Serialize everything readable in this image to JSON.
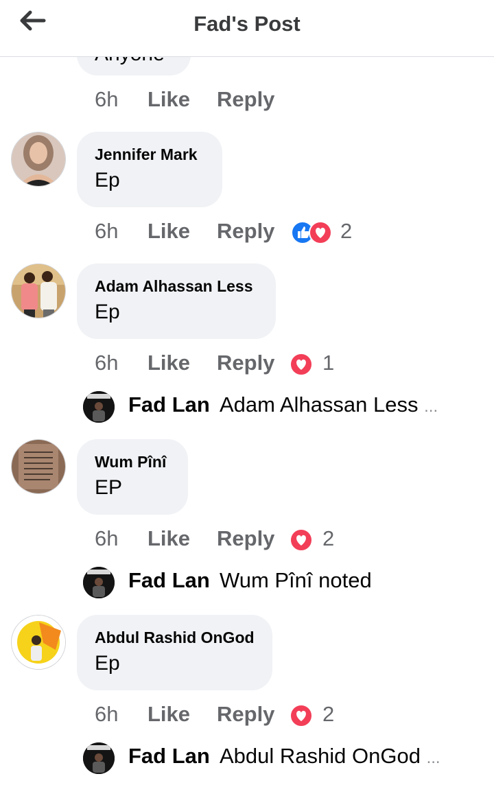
{
  "header": {
    "title": "Fad's Post"
  },
  "partial_comment": {
    "text": "Anyone",
    "time": "6h",
    "like": "Like",
    "reply": "Reply"
  },
  "comments": [
    {
      "name": "Jennifer Mark",
      "text": "Ep",
      "time": "6h",
      "like": "Like",
      "reply": "Reply",
      "reactions": [
        "like-icon",
        "love-icon"
      ],
      "reaction_count": "2"
    },
    {
      "name": "Adam Alhassan Less",
      "text": "Ep",
      "time": "6h",
      "like": "Like",
      "reply": "Reply",
      "reactions": [
        "love-icon"
      ],
      "reaction_count": "1",
      "reply_preview": {
        "name": "Fad Lan",
        "text": "Adam Alhassan Less",
        "ellipsis": "..."
      }
    },
    {
      "name": "Wum Pînî",
      "text": "EP",
      "time": "6h",
      "like": "Like",
      "reply": "Reply",
      "reactions": [
        "love-icon"
      ],
      "reaction_count": "2",
      "reply_preview": {
        "name": "Fad Lan",
        "text": "Wum Pînî noted",
        "ellipsis": ""
      }
    },
    {
      "name": "Abdul Rashid OnGod",
      "text": "Ep",
      "time": "6h",
      "like": "Like",
      "reply": "Reply",
      "reactions": [
        "love-icon"
      ],
      "reaction_count": "2",
      "reply_preview": {
        "name": "Fad Lan",
        "text": "Abdul Rashid OnGod",
        "ellipsis": "..."
      }
    }
  ],
  "colors": {
    "like_blue": "#1877f2",
    "love_red": "#f33e58",
    "bubble_bg": "#f0f2f5",
    "meta_gray": "#65676b"
  }
}
